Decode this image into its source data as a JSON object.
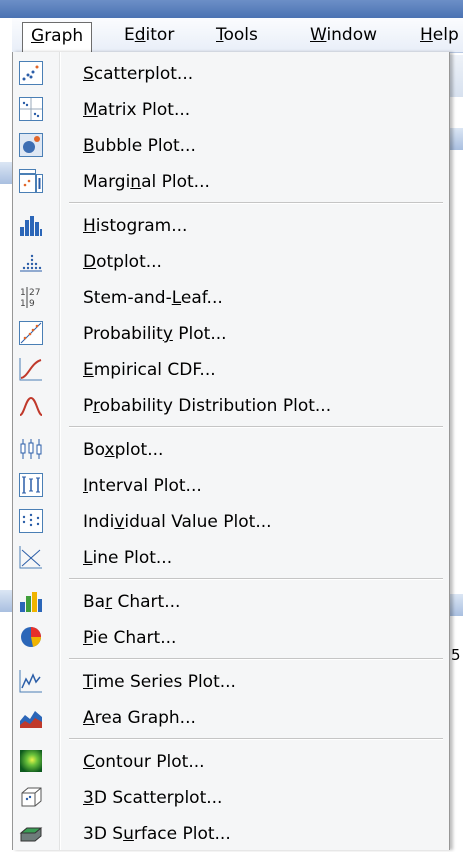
{
  "menubar": {
    "items": [
      {
        "label": "Graph",
        "mnemonic": "G"
      },
      {
        "label": "Editor",
        "mnemonic": "d"
      },
      {
        "label": "Tools",
        "mnemonic": "T"
      },
      {
        "label": "Window",
        "mnemonic": "W"
      },
      {
        "label": "Help",
        "mnemonic": "H"
      }
    ],
    "active": "Graph"
  },
  "menu": {
    "groups": [
      [
        {
          "label": "Scatterplot...",
          "icon": "scatterplot-icon"
        },
        {
          "label": "Matrix Plot...",
          "icon": "matrix-plot-icon"
        },
        {
          "label": "Bubble Plot...",
          "icon": "bubble-plot-icon"
        },
        {
          "label": "Marginal Plot...",
          "icon": "marginal-plot-icon"
        }
      ],
      [
        {
          "label": "Histogram...",
          "icon": "histogram-icon"
        },
        {
          "label": "Dotplot...",
          "icon": "dotplot-icon"
        },
        {
          "label": "Stem-and-Leaf...",
          "icon": "stem-and-leaf-icon"
        },
        {
          "label": "Probability Plot...",
          "icon": "probability-plot-icon"
        },
        {
          "label": "Empirical CDF...",
          "icon": "empirical-cdf-icon"
        },
        {
          "label": "Probability Distribution Plot...",
          "icon": "probability-distribution-icon"
        }
      ],
      [
        {
          "label": "Boxplot...",
          "icon": "boxplot-icon"
        },
        {
          "label": "Interval Plot...",
          "icon": "interval-plot-icon"
        },
        {
          "label": "Individual Value Plot...",
          "icon": "individual-value-plot-icon"
        },
        {
          "label": "Line Plot...",
          "icon": "line-plot-icon"
        }
      ],
      [
        {
          "label": "Bar Chart...",
          "icon": "bar-chart-icon"
        },
        {
          "label": "Pie Chart...",
          "icon": "pie-chart-icon"
        }
      ],
      [
        {
          "label": "Time Series Plot...",
          "icon": "time-series-plot-icon"
        },
        {
          "label": "Area Graph...",
          "icon": "area-graph-icon"
        }
      ],
      [
        {
          "label": "Contour Plot...",
          "icon": "contour-plot-icon"
        },
        {
          "label": "3D Scatterplot...",
          "icon": "3d-scatterplot-icon"
        },
        {
          "label": "3D Surface Plot...",
          "icon": "3d-surface-plot-icon"
        }
      ]
    ]
  },
  "background": {
    "right_edge_text": "5"
  }
}
